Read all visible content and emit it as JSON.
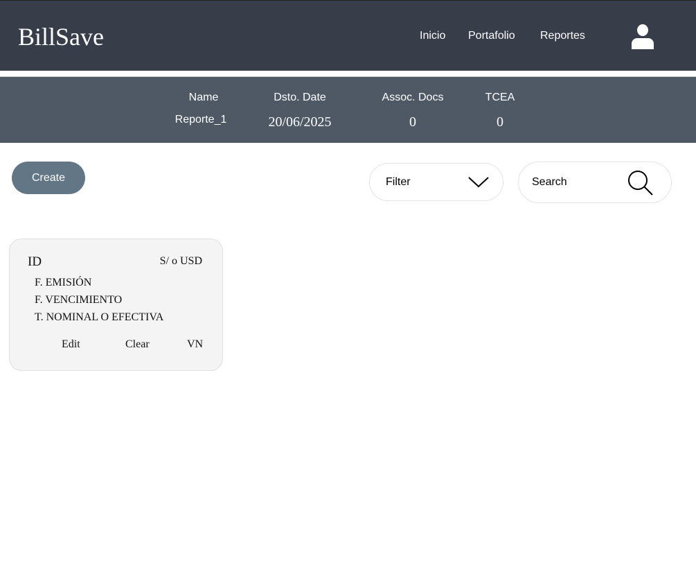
{
  "nav": {
    "logo": "BillSave",
    "links": [
      "Inicio",
      "Portafolio",
      "Reportes"
    ]
  },
  "summary": {
    "headers": [
      "Name",
      "Dsto. Date",
      "Assoc. Docs",
      "TCEA"
    ],
    "values": [
      "Reporte_1",
      "20/06/2025",
      "0",
      "0"
    ]
  },
  "toolbar": {
    "create": "Create",
    "filter": "Filter",
    "search": "Search"
  },
  "card": {
    "id": "ID",
    "currency": "S/ o USD",
    "fields": [
      "F. EMISIÓN",
      "F. VENCIMIENTO",
      "T. NOMINAL O EFECTIVA"
    ],
    "actions": [
      "Edit",
      "Clear",
      "VN"
    ]
  }
}
